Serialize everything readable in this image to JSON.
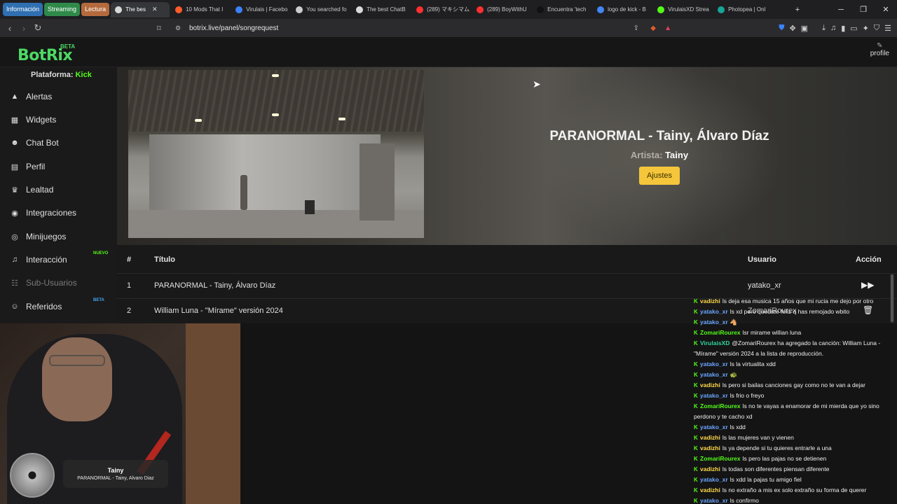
{
  "browser": {
    "tab_groups": [
      {
        "label": "Información",
        "color": "#2f6fb2"
      },
      {
        "label": "Streaming",
        "color": "#2f8a4a"
      },
      {
        "label": "Lectura",
        "color": "#b46a3c"
      }
    ],
    "tabs": [
      {
        "label": "The bes",
        "color": "#d9d9d9",
        "active": true
      },
      {
        "label": "10 Mods That I",
        "color": "#ff5b2a"
      },
      {
        "label": "Virulais | Facebo",
        "color": "#3b82f6"
      },
      {
        "label": "You searched fo",
        "color": "#cccccc",
        "glyph": "S"
      },
      {
        "label": "The best ChatB",
        "color": "#d9d9d9"
      },
      {
        "label": "(289) マキシマム",
        "color": "#ff3030"
      },
      {
        "label": "(289) BoyWithU",
        "color": "#ff3030"
      },
      {
        "label": "Encuentra 'tech",
        "color": "#111111"
      },
      {
        "label": "logo de kick - B",
        "color": "#4285f4"
      },
      {
        "label": "VirulaisXD Strea",
        "color": "#53fc18"
      },
      {
        "label": "Photopea | Onl",
        "color": "#18a497"
      }
    ],
    "url": "botrix.live/panel/songrequest"
  },
  "app": {
    "logo": "BotRix",
    "logo_tag": "BETA",
    "profile_label": "profile",
    "platform_label": "Plataforma:",
    "platform_value": "Kick"
  },
  "sidebar": {
    "items": [
      {
        "label": "Alertas",
        "icon": "warning-icon",
        "glyph": "▲"
      },
      {
        "label": "Widgets",
        "icon": "widgets-icon",
        "glyph": "▦"
      },
      {
        "label": "Chat Bot",
        "icon": "robot-icon",
        "glyph": "☻"
      },
      {
        "label": "Perfil",
        "icon": "id-card-icon",
        "glyph": "▤"
      },
      {
        "label": "Lealtad",
        "icon": "trophy-icon",
        "glyph": "♛"
      },
      {
        "label": "Integraciones",
        "icon": "discord-icon",
        "glyph": "◉"
      },
      {
        "label": "Minijuegos",
        "icon": "gamepad-icon",
        "glyph": "◎"
      },
      {
        "label": "Interacción",
        "icon": "music-icon",
        "glyph": "♫",
        "tag": "NUEVO"
      },
      {
        "label": "Sub-Usuarios",
        "icon": "users-icon",
        "glyph": "☷",
        "disabled": true
      },
      {
        "label": "Referidos",
        "icon": "referral-icon",
        "glyph": "☺",
        "tag": "BETA"
      }
    ]
  },
  "now_playing": {
    "title": "PARANORMAL - Tainy, Álvaro Díaz",
    "artist_label": "Artista:",
    "artist": "Tainy",
    "settings_button": "Ajustes"
  },
  "queue": {
    "headers": {
      "num": "#",
      "title": "Título",
      "user": "Usuario",
      "action": "Acción"
    },
    "rows": [
      {
        "num": "1",
        "title": "PARANORMAL - Tainy, Álvaro Díaz",
        "user": "yatako_xr",
        "action_icon": "skip-icon"
      },
      {
        "num": "2",
        "title": "William Luna - \"Mírame\" versión 2024",
        "user": "ZomariRourex",
        "action_icon": "trash-icon"
      }
    ]
  },
  "overlay_card": {
    "title": "Tainy",
    "subtitle": "PARANORMAL - Tainy, Alvaro Diaz"
  },
  "chat": {
    "messages": [
      {
        "user": "vadizhi",
        "color": "#ffd84a",
        "text": "ls deja esa musica 15 años que mi rucia me dejo por otro"
      },
      {
        "user": "yatako_xr",
        "color": "#6aa5ff",
        "text": "ls xd pero quedate feliz q has remojado wbito"
      },
      {
        "user": "yatako_xr",
        "color": "#6aa5ff",
        "text": "🐴"
      },
      {
        "user": "ZomariRourex",
        "color": "#53fc18",
        "text": "lsr mirame willian luna"
      },
      {
        "user": "VirulaisXD",
        "color": "#2fd4a0",
        "text": "@ZomariRourex ha agregado la canción: William Luna - \"Mírame\" versión 2024 a la lista de reproducción."
      },
      {
        "user": "yatako_xr",
        "color": "#6aa5ff",
        "text": "ls la virtualita xdd"
      },
      {
        "user": "yatako_xr",
        "color": "#6aa5ff",
        "text": "🐢"
      },
      {
        "user": "vadizhi",
        "color": "#ffd84a",
        "text": "ls pero si bailas canciones gay como no te van a dejar"
      },
      {
        "user": "yatako_xr",
        "color": "#6aa5ff",
        "text": "ls frio o freyo"
      },
      {
        "user": "ZomariRourex",
        "color": "#53fc18",
        "text": "ls no te vayas a enamorar de mi mierda que yo sino perdono y te cacho xd"
      },
      {
        "user": "yatako_xr",
        "color": "#6aa5ff",
        "text": "ls xdd"
      },
      {
        "user": "vadizhi",
        "color": "#ffd84a",
        "text": "ls las mujeres van y vienen"
      },
      {
        "user": "vadizhi",
        "color": "#ffd84a",
        "text": "ls ya depende si tu quieres entrarle a una"
      },
      {
        "user": "ZomariRourex",
        "color": "#53fc18",
        "text": "ls pero las pajas no se detienen"
      },
      {
        "user": "vadizhi",
        "color": "#ffd84a",
        "text": "ls todas son diferentes piensan diferente"
      },
      {
        "user": "yatako_xr",
        "color": "#6aa5ff",
        "text": "ls xdd la pajas tu amigo fiel"
      },
      {
        "user": "vadizhi",
        "color": "#ffd84a",
        "text": "ls no extraño a mis ex solo extraño su forma de querer"
      },
      {
        "user": "yatako_xr",
        "color": "#6aa5ff",
        "text": "ls confirmo"
      }
    ]
  }
}
